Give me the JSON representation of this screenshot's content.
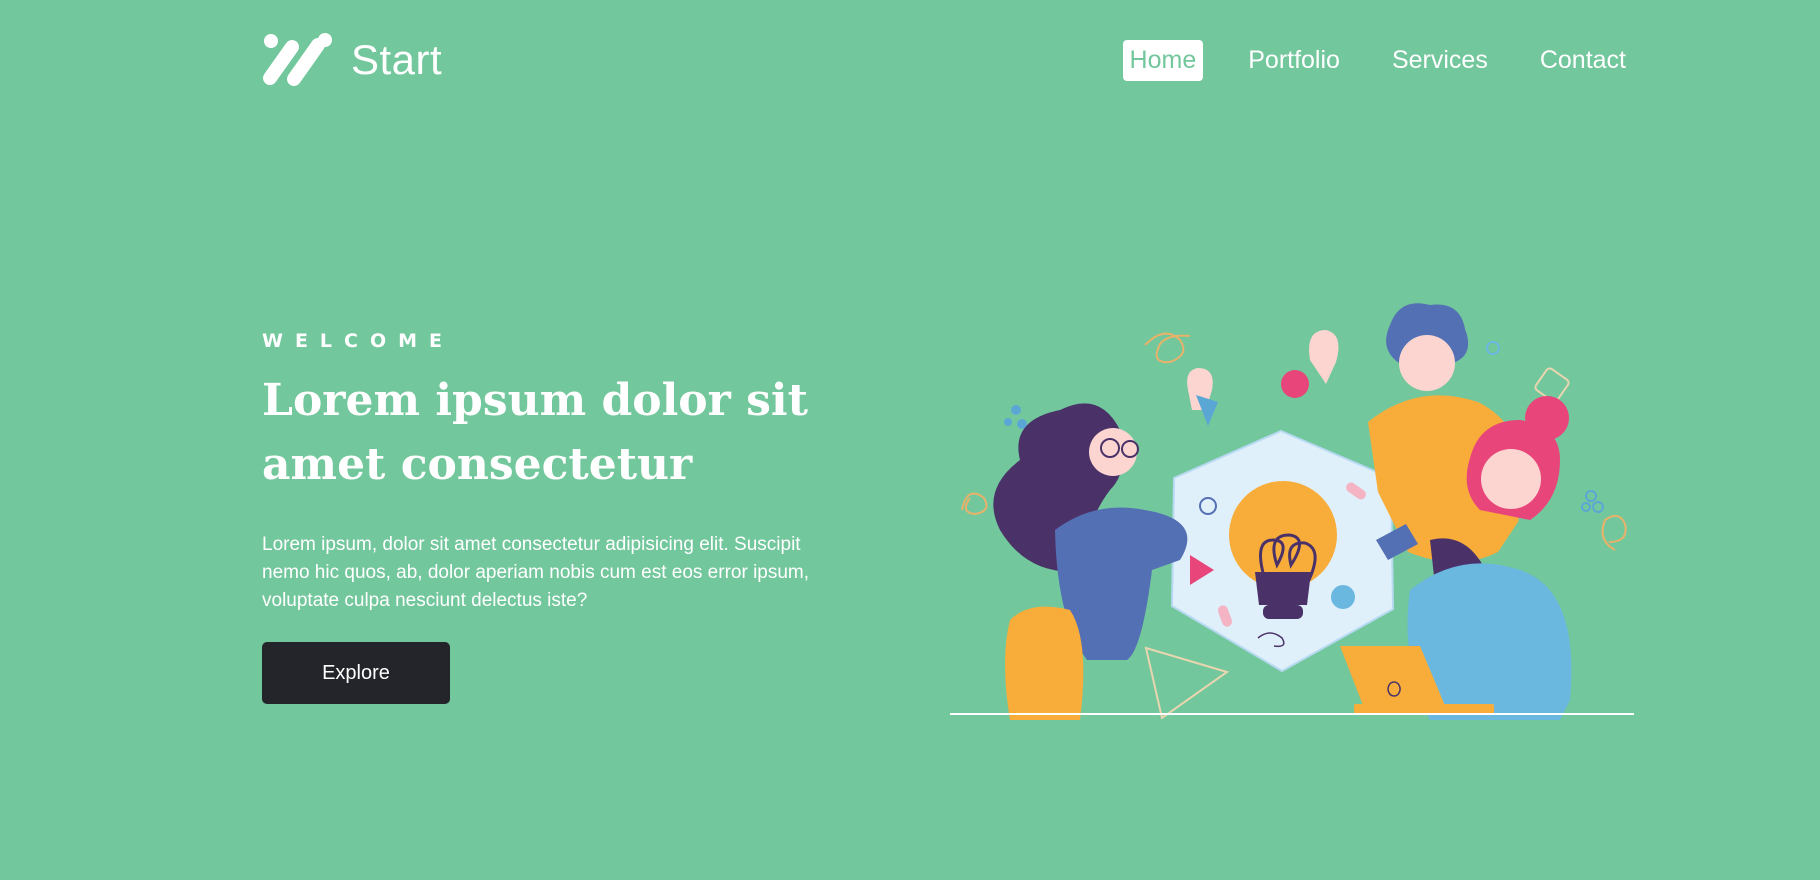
{
  "brand": {
    "name": "Start",
    "logo_icon": "slanted-bars-logo-icon"
  },
  "nav": {
    "items": [
      {
        "label": "Home",
        "active": true
      },
      {
        "label": "Portfolio",
        "active": false
      },
      {
        "label": "Services",
        "active": false
      },
      {
        "label": "Contact",
        "active": false
      }
    ]
  },
  "hero": {
    "eyebrow": "WELCOME",
    "headline_line1": "Lorem ipsum dolor sit",
    "headline_line2": "amet consectetur",
    "paragraph_line1": "Lorem ipsum, dolor sit amet consectetur adipisicing elit. Suscipit",
    "paragraph_line2": "nemo hic quos, ab, dolor aperiam nobis cum est eos error ipsum,",
    "paragraph_line3": "voluptate culpa nesciunt delectus iste?",
    "cta_label": "Explore",
    "illustration_icon": "team-ideas-lightbulb-illustration"
  },
  "colors": {
    "background": "#73c79c",
    "button": "#23252a",
    "text": "#ffffff",
    "accent_yellow": "#f8ad3b",
    "accent_pink": "#e8457a",
    "accent_blue": "#5470b4",
    "accent_sky": "#6ab8e0",
    "accent_purple": "#4a3269"
  }
}
